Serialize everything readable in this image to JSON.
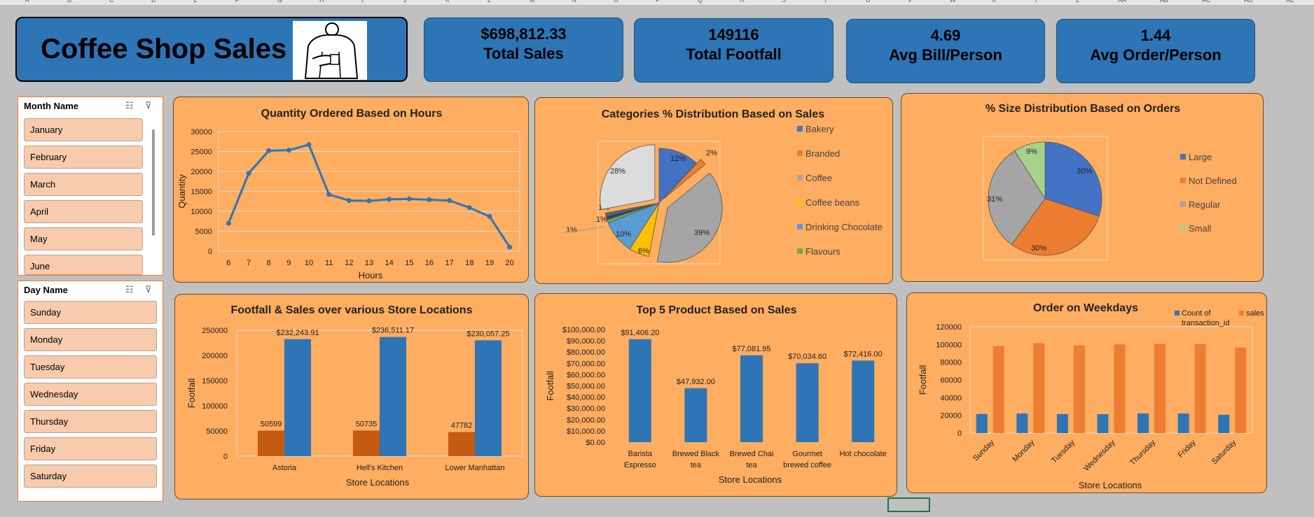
{
  "column_headers": [
    "A",
    "B",
    "C",
    "D",
    "E",
    "F",
    "G",
    "H",
    "I",
    "J",
    "K",
    "L",
    "M",
    "N",
    "O",
    "P",
    "Q",
    "R",
    "S",
    "T",
    "U",
    "V",
    "W",
    "X",
    "Y",
    "Z",
    "AA",
    "AB",
    "AC",
    "AD",
    "AE"
  ],
  "dashboard": {
    "title": "Coffee Shop Sales"
  },
  "kpis": [
    {
      "value": "$698,812.33",
      "label": "Total Sales"
    },
    {
      "value": "149116",
      "label": "Total Footfall"
    },
    {
      "value": "4.69",
      "label": "Avg Bill/Person"
    },
    {
      "value": "1.44",
      "label": "Avg Order/Person"
    }
  ],
  "month_slicer": {
    "header": "Month Name",
    "items": [
      "January",
      "February",
      "March",
      "April",
      "May",
      "June"
    ]
  },
  "day_slicer": {
    "header": "Day Name",
    "items": [
      "Sunday",
      "Monday",
      "Tuesday",
      "Wednesday",
      "Thursday",
      "Friday",
      "Saturday"
    ]
  },
  "colors": {
    "blue": "#2e75b6",
    "dark_orange": "#c55a11",
    "orange": "#ed7d31",
    "panel": "#ffad60",
    "line": "#2e75b6"
  },
  "chart_data": [
    {
      "type": "line",
      "title": "Quantity Ordered Based on Hours",
      "xlabel": "Hours",
      "ylabel": "Quantity",
      "x": [
        6,
        7,
        8,
        9,
        10,
        11,
        12,
        13,
        14,
        15,
        16,
        17,
        18,
        19,
        20
      ],
      "values": [
        7000,
        19500,
        25200,
        25300,
        26700,
        14200,
        12700,
        12600,
        13000,
        13100,
        12900,
        12700,
        10900,
        8700,
        1000
      ],
      "yticks": [
        0,
        5000,
        10000,
        15000,
        20000,
        25000,
        30000
      ],
      "ylim": [
        0,
        30000
      ],
      "grid": true
    },
    {
      "type": "pie",
      "title": "Categories % Distribution Based on Sales",
      "legend": [
        "Bakery",
        "Branded",
        "Coffee",
        "Coffee beans",
        "Drinking Chocolate",
        "Flavours"
      ],
      "slices": [
        {
          "label": "Bakery",
          "pct": 12,
          "text": "12%",
          "color": "#4472c4"
        },
        {
          "label": "Branded",
          "pct": 2,
          "text": "2%",
          "color": "#ed7d31"
        },
        {
          "label": "Coffee",
          "pct": 39,
          "text": "39%",
          "color": "#a5a5a5"
        },
        {
          "label": "Coffee beans",
          "pct": 6,
          "text": "6%",
          "color": "#ffc000"
        },
        {
          "label": "Drinking Chocolate",
          "pct": 10,
          "text": "10%",
          "color": "#5b9bd5"
        },
        {
          "label": "Flavours",
          "pct": 1,
          "text": "1%",
          "color": "#70ad47"
        },
        {
          "label": "",
          "pct": 1,
          "text": "1%",
          "color": "#264478"
        },
        {
          "label": "",
          "pct": 1,
          "text": "1%",
          "color": "#636363"
        },
        {
          "label": "",
          "pct": 28,
          "text": "28%",
          "color": "#dcdcdc"
        }
      ]
    },
    {
      "type": "pie",
      "title": "% Size Distribution Based on Orders",
      "legend": [
        "Large",
        "Not Defined",
        "Regular",
        "Small"
      ],
      "slices": [
        {
          "label": "Large",
          "pct": 30,
          "text": "30%",
          "color": "#4472c4"
        },
        {
          "label": "Not Defined",
          "pct": 30,
          "text": "30%",
          "color": "#ed7d31"
        },
        {
          "label": "Regular",
          "pct": 31,
          "text": "31%",
          "color": "#a5a5a5"
        },
        {
          "label": "Small",
          "pct": 9,
          "text": "9%",
          "color": "#a9d18e"
        }
      ]
    },
    {
      "type": "bar",
      "title": "Footfall & Sales  over various Store Locations",
      "xlabel": "Store Locations",
      "ylabel": "Footfall",
      "categories": [
        "Astoria",
        "Hell's Kitchen",
        "Lower Manhattan"
      ],
      "series": [
        {
          "values": [
            50599,
            50735,
            47782
          ],
          "labels": [
            "50599",
            "50735",
            "47782"
          ]
        },
        {
          "values": [
            232243.91,
            236511.17,
            230057.25
          ],
          "labels": [
            "$232,243.91",
            "$236,511.17",
            "$230,057.25"
          ]
        }
      ],
      "yticks": [
        0,
        50000,
        100000,
        150000,
        200000,
        250000
      ],
      "ylim": [
        0,
        250000
      ]
    },
    {
      "type": "bar",
      "title": "Top 5 Product Based on Sales",
      "xlabel": "Store Locations",
      "ylabel": "Footfall",
      "categories": [
        [
          "Barista",
          "Espresso"
        ],
        [
          "Brewed Black",
          "tea"
        ],
        [
          "Brewed Chai",
          "tea"
        ],
        [
          "Gourmet",
          "brewed coffee"
        ],
        [
          "Hot chocolate"
        ]
      ],
      "values": [
        91406.2,
        47932.0,
        77081.95,
        70034.6,
        72416.0
      ],
      "labels": [
        "$91,406.20",
        "$47,932.00",
        "$77,081.95",
        "$70,034.60",
        "$72,416.00"
      ],
      "yticks": [
        "$0.00",
        "$10,000.00",
        "$20,000.00",
        "$30,000.00",
        "$40,000.00",
        "$50,000.00",
        "$60,000.00",
        "$70,000.00",
        "$80,000.00",
        "$90,000.00",
        "$100,000.00"
      ],
      "ylim": [
        0,
        100000
      ]
    },
    {
      "type": "bar",
      "title": "Order on Weekdays",
      "xlabel": "Store Locations",
      "ylabel": "Footfall",
      "categories": [
        "Sunday",
        "Monday",
        "Tuesday",
        "Wednesday",
        "Thursday",
        "Friday",
        "Saturday"
      ],
      "series": [
        {
          "name": "Count of transaction_id",
          "values": [
            21500,
            22000,
            21400,
            21300,
            22100,
            22000,
            20600
          ]
        },
        {
          "name": "sales",
          "values": [
            98000,
            101500,
            98800,
            100000,
            100600,
            100500,
            96500
          ]
        }
      ],
      "yticks": [
        0,
        20000,
        40000,
        60000,
        80000,
        100000,
        120000
      ],
      "ylim": [
        0,
        120000
      ]
    }
  ]
}
